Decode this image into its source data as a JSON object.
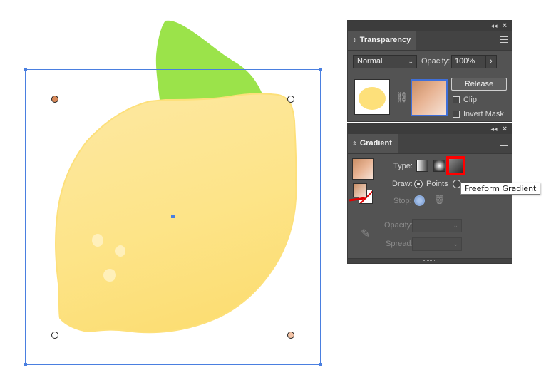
{
  "canvas": {
    "lemon_color": "#fde07a",
    "leaf_color": "#9be34a",
    "selection_color": "#4a7fe0",
    "point_colors": [
      "#d98a5a",
      "#ffffff",
      "#ffffff",
      "#f2c3a6"
    ]
  },
  "transparency_panel": {
    "title": "Transparency",
    "blend_mode": "Normal",
    "opacity_label": "Opacity:",
    "opacity_value": "100%",
    "release_label": "Release",
    "clip_label": "Clip",
    "invert_mask_label": "Invert Mask"
  },
  "gradient_panel": {
    "title": "Gradient",
    "type_label": "Type:",
    "draw_label": "Draw:",
    "points_label": "Points",
    "stop_label": "Stop:",
    "opacity_label": "Opacity:",
    "spread_label": "Spread:",
    "tooltip": "Freeform Gradient",
    "highlight_color": "#ff0000"
  }
}
